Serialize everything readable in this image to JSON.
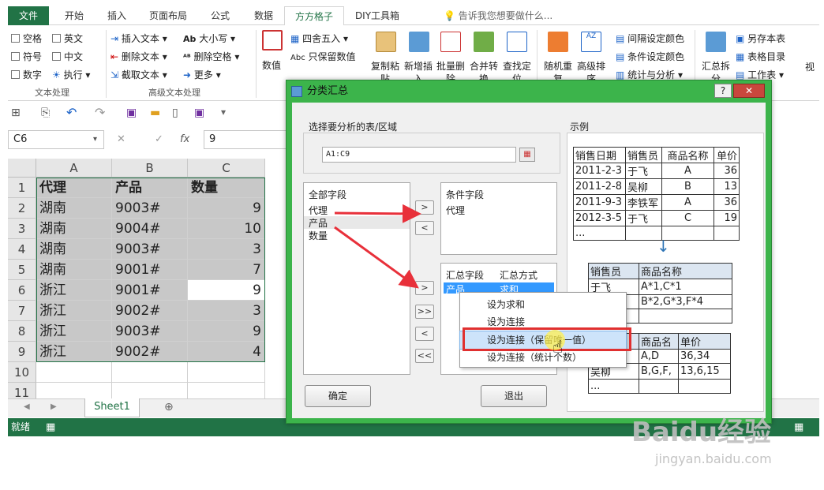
{
  "tabs": [
    "文件",
    "开始",
    "插入",
    "页面布局",
    "公式",
    "数据",
    "方方格子",
    "DIY工具箱"
  ],
  "tell_me": "告诉我您想要做什么...",
  "ribbon": {
    "checks": [
      "空格",
      "英文",
      "符号",
      "中文",
      "数字"
    ],
    "exec": "执行",
    "text_ops": [
      "插入文本",
      "删除文本",
      "截取文本"
    ],
    "text_ops2": [
      "大小写",
      "删除空格",
      "更多"
    ],
    "group_text": "文本处理",
    "group_adv_text": "高级文本处理",
    "numeric": "数值",
    "round": "四舍五入",
    "keep_num": "只保留数值",
    "big_buttons": [
      "复制粘贴",
      "新增插入",
      "批量删除",
      "合并转换",
      "查找定位",
      "随机重复",
      "高级排序"
    ],
    "right_items": [
      "间隔设定颜色",
      "条件设定颜色",
      "统计与分析"
    ],
    "summary_split": "汇总拆分",
    "save_as": "另存本表",
    "sheet_dir": "表格目录",
    "workbook": "工作表",
    "view": "视"
  },
  "name_box": "C6",
  "formula_value": "9",
  "columns": [
    "A",
    "B",
    "C"
  ],
  "rows": [
    "1",
    "2",
    "3",
    "4",
    "5",
    "6",
    "7",
    "8",
    "9",
    "10",
    "11"
  ],
  "cells": [
    [
      "代理",
      "产品",
      "数量"
    ],
    [
      "湖南",
      "9003#",
      "9"
    ],
    [
      "湖南",
      "9004#",
      "10"
    ],
    [
      "湖南",
      "9003#",
      "3"
    ],
    [
      "湖南",
      "9001#",
      "7"
    ],
    [
      "浙江",
      "9001#",
      "9"
    ],
    [
      "浙江",
      "9002#",
      "3"
    ],
    [
      "浙江",
      "9003#",
      "9"
    ],
    [
      "浙江",
      "9002#",
      "4"
    ]
  ],
  "sheet_tab": "Sheet1",
  "status": "就绪",
  "dialog": {
    "title": "分类汇总",
    "select_label": "选择要分析的表/区域",
    "range": "A1:C9",
    "all_fields_label": "全部字段",
    "all_fields": [
      "代理",
      "产品",
      "数量"
    ],
    "cond_label": "条件字段",
    "cond_fields": [
      "代理"
    ],
    "sum_field_label": "汇总字段",
    "sum_method_label": "汇总方式",
    "sum_row": [
      "产品",
      "求和"
    ],
    "ok": "确定",
    "exit": "退出",
    "example_label": "示例",
    "example1": [
      [
        "销售日期",
        "销售员",
        "商品名称",
        "单价"
      ],
      [
        "2011-2-3",
        "于飞",
        "A",
        "36"
      ],
      [
        "2011-2-8",
        "吴柳",
        "B",
        "13"
      ],
      [
        "2011-9-3",
        "李铁军",
        "A",
        "36"
      ],
      [
        "2012-3-5",
        "于飞",
        "C",
        "19"
      ],
      [
        "...",
        "",
        "",
        ""
      ]
    ],
    "example2": [
      [
        "销售员",
        "商品名称"
      ],
      [
        "于飞",
        "A*1,C*1"
      ],
      [
        "",
        "B*2,G*3,F*4"
      ],
      [
        "",
        ""
      ]
    ],
    "example3": [
      [
        "",
        "商品名",
        "单价"
      ],
      [
        "",
        "A,D",
        "36,34"
      ],
      [
        "吴柳",
        "B,G,F,",
        "13,6,15"
      ],
      [
        "...",
        "",
        ""
      ]
    ]
  },
  "context_menu": [
    "设为求和",
    "设为连接",
    "设为连接（保留唯一值）",
    "设为连接（统计个数）"
  ],
  "watermark": {
    "brand": "Baidu经验",
    "url": "jingyan.baidu.com"
  },
  "colors": {
    "excel_green": "#217346",
    "dialog_green": "#3cb44b",
    "arrow_red": "#e8303a"
  }
}
